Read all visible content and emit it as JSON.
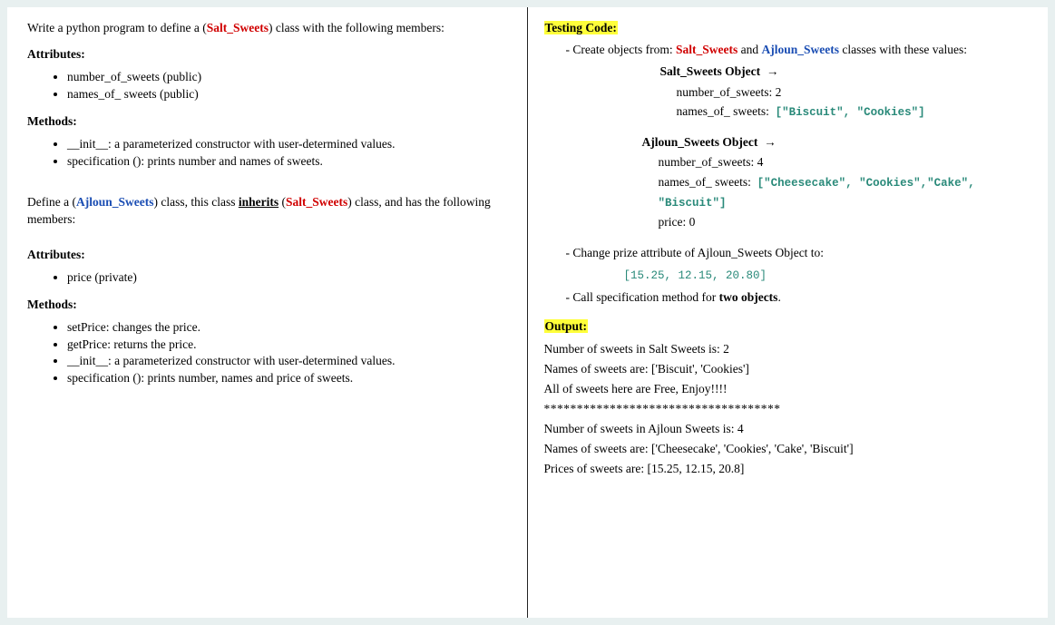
{
  "left": {
    "intro_pre": "Write a python program to define a (",
    "intro_class": "Salt_Sweets",
    "intro_post": ") class with the following members:",
    "attributes_title": "Attributes:",
    "attrs1": [
      "number_of_sweets (public)",
      "names_of_ sweets (public)"
    ],
    "methods_title": "Methods:",
    "methods1": [
      "__init__: a parameterized constructor with user-determined values.",
      "specification (): prints number and names of sweets."
    ],
    "define_pre": "Define a (",
    "define_class": "Ajloun_Sweets",
    "define_mid1": ") class, this class ",
    "define_inherits": "inherits",
    "define_mid2": " (",
    "define_parent": "Salt_Sweets",
    "define_post": ") class, and has the following members:",
    "attrs2": [
      "price (private)"
    ],
    "methods2": [
      "setPrice: changes the price.",
      "getPrice: returns the price.",
      "__init__: a parameterized constructor with user-determined values.",
      "specification (): prints number, names and price of sweets."
    ]
  },
  "right": {
    "testing_title": "Testing Code:",
    "create_pre": "Create objects from: ",
    "create_c1": "Salt_Sweets",
    "create_and": " and ",
    "create_c2": "Ajloun_Sweets",
    "create_post": " classes with these values:",
    "salt_obj_title": "Salt_Sweets Object",
    "arrow": "→",
    "salt_num_label": "number_of_sweets:",
    "salt_num_val": "  2",
    "salt_names_label": "names_of_ sweets:",
    "salt_names_val": "[\"Biscuit\", \"Cookies\"]",
    "ajl_obj_title": "Ajloun_Sweets Object",
    "ajl_num_label": "number_of_sweets:",
    "ajl_num_val": "  4",
    "ajl_names_label": "names_of_ sweets:",
    "ajl_names_val": "[\"Cheesecake\", \"Cookies\",\"Cake\", \"Biscuit\"]",
    "ajl_price_label": "price:",
    "ajl_price_val": "  0",
    "change_text": "Change prize attribute of Ajloun_Sweets Object to:",
    "change_val": "[15.25, 12.15, 20.80]",
    "call_pre": "Call specification method for ",
    "call_bold": "two objects",
    "call_post": ".",
    "output_title": "Output:",
    "out1": "Number of sweets in Salt Sweets is: 2",
    "out2": "Names of sweets are: ['Biscuit', 'Cookies']",
    "out3": "All of sweets here are Free, Enjoy!!!!",
    "stars": "************************************",
    "out4": "Number of sweets in Ajloun Sweets is: 4",
    "out5": "Names of sweets are: ['Cheesecake', 'Cookies', 'Cake', 'Biscuit']",
    "out6": "Prices of sweets are: [15.25, 12.15, 20.8]"
  }
}
